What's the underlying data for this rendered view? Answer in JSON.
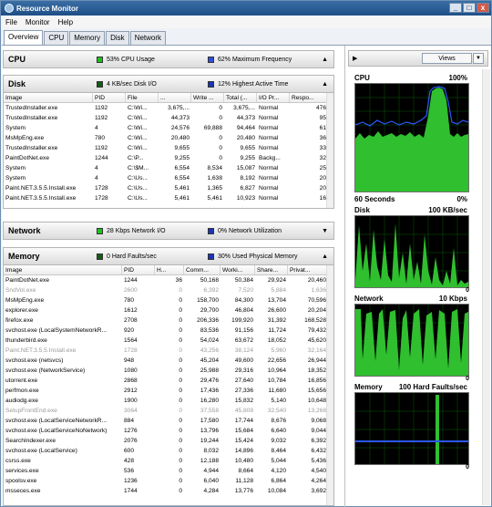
{
  "window": {
    "title": "Resource Monitor",
    "min": "_",
    "max": "□",
    "close": "x"
  },
  "menu": [
    "File",
    "Monitor",
    "Help"
  ],
  "tabs": [
    "Overview",
    "CPU",
    "Memory",
    "Disk",
    "Network"
  ],
  "cpu": {
    "title": "CPU",
    "ind1": "53% CPU Usage",
    "ind1_color": "#1cc41c",
    "ind2": "62% Maximum Frequency",
    "ind2_color": "#2f4fd8"
  },
  "disk": {
    "title": "Disk",
    "ind1": "4 KB/sec Disk I/O",
    "ind1_color": "#155c15",
    "ind2": "12% Highest Active Time",
    "ind2_color": "#1a35b8",
    "columns": [
      "Image",
      "PID",
      "File",
      "...",
      "Write ...",
      "Total (...",
      "I/O Pr...",
      "Respo..."
    ],
    "rows": [
      [
        "TrustedInstaller.exe",
        "1192",
        "C:\\Wi...",
        "3,675,...",
        "0",
        "3,675,...",
        "Normal",
        "476"
      ],
      [
        "TrustedInstaller.exe",
        "1192",
        "C:\\Wi...",
        "44,373",
        "0",
        "44,373",
        "Normal",
        "95"
      ],
      [
        "System",
        "4",
        "C:\\Wi...",
        "24,576",
        "69,888",
        "94,464",
        "Normal",
        "61"
      ],
      [
        "MsMpEng.exe",
        "780",
        "C:\\Wi...",
        "20,480",
        "0",
        "20,480",
        "Normal",
        "36"
      ],
      [
        "TrustedInstaller.exe",
        "1192",
        "C:\\Wi...",
        "9,655",
        "0",
        "9,655",
        "Normal",
        "33"
      ],
      [
        "PaintDotNet.exe",
        "1244",
        "C:\\P...",
        "9,255",
        "0",
        "9,255",
        "Backg...",
        "32"
      ],
      [
        "System",
        "4",
        "C:\\$M...",
        "6,554",
        "8,534",
        "15,087",
        "Normal",
        "25"
      ],
      [
        "System",
        "4",
        "C:\\Us...",
        "6,554",
        "1,638",
        "8,192",
        "Normal",
        "20"
      ],
      [
        "Paint.NET.3.5.5.Install.exe",
        "1728",
        "C:\\Us...",
        "5,461",
        "1,365",
        "6,827",
        "Normal",
        "20"
      ],
      [
        "Paint.NET.3.5.5.Install.exe",
        "1728",
        "C:\\Us...",
        "5,461",
        "5,461",
        "10,923",
        "Normal",
        "16"
      ]
    ]
  },
  "network": {
    "title": "Network",
    "ind1": "28 Kbps Network I/O",
    "ind1_color": "#1cc41c",
    "ind2": "0% Network Utilization",
    "ind2_color": "#1a35b8"
  },
  "memory": {
    "title": "Memory",
    "ind1": "0 Hard Faults/sec",
    "ind1_color": "#155c15",
    "ind2": "30% Used Physical Memory",
    "ind2_color": "#1a35b8",
    "columns": [
      "Image",
      "PID",
      "H...",
      "Comm...",
      "Worki...",
      "Share...",
      "Privat..."
    ],
    "rows": [
      [
        "PaintDotNet.exe",
        "1244",
        "36",
        "50,168",
        "50,384",
        "29,924",
        "20,460",
        false
      ],
      [
        "SndVol.exe",
        "2600",
        "0",
        "6,392",
        "7,520",
        "5,884",
        "1,636",
        true
      ],
      [
        "MsMpEng.exe",
        "780",
        "0",
        "158,700",
        "84,300",
        "13,704",
        "70,596",
        false
      ],
      [
        "explorer.exe",
        "1612",
        "0",
        "29,700",
        "46,804",
        "26,600",
        "20,204",
        false
      ],
      [
        "firefox.exe",
        "2708",
        "0",
        "206,336",
        "199,920",
        "31,392",
        "168,528",
        false
      ],
      [
        "svchost.exe (LocalSystemNetworkR...",
        "920",
        "0",
        "83,536",
        "91,156",
        "11,724",
        "79,432",
        false
      ],
      [
        "thunderbird.exe",
        "1564",
        "0",
        "54,024",
        "63,672",
        "18,052",
        "45,620",
        false
      ],
      [
        "Paint.NET.3.5.5.Install.exe",
        "1728",
        "0",
        "43,256",
        "38,124",
        "5,960",
        "32,164",
        true
      ],
      [
        "svchost.exe (netsvcs)",
        "948",
        "0",
        "45,204",
        "49,600",
        "22,656",
        "26,944",
        false
      ],
      [
        "svchost.exe (NetworkService)",
        "1080",
        "0",
        "25,988",
        "29,316",
        "10,964",
        "18,352",
        false
      ],
      [
        "utorrent.exe",
        "2868",
        "0",
        "29,476",
        "27,640",
        "10,784",
        "16,856",
        false
      ],
      [
        "perfmon.exe",
        "2912",
        "0",
        "17,436",
        "27,336",
        "11,680",
        "15,656",
        false
      ],
      [
        "audiodg.exe",
        "1900",
        "0",
        "16,280",
        "15,832",
        "5,140",
        "10,648",
        false
      ],
      [
        "SetupFrontEnd.exe",
        "3064",
        "0",
        "37,558",
        "45,808",
        "32,540",
        "13,268",
        true
      ],
      [
        "svchost.exe (LocalServiceNetworkR...",
        "884",
        "0",
        "17,580",
        "17,744",
        "8,676",
        "9,068",
        false
      ],
      [
        "svchost.exe (LocalServiceNoNetwork)",
        "1276",
        "0",
        "13,796",
        "15,684",
        "6,640",
        "9,044",
        false
      ],
      [
        "SearchIndexer.exe",
        "2076",
        "0",
        "19,244",
        "15,424",
        "9,032",
        "6,392",
        false
      ],
      [
        "svchost.exe (LocalService)",
        "600",
        "0",
        "8,032",
        "14,896",
        "8,464",
        "6,432",
        false
      ],
      [
        "csrss.exe",
        "428",
        "0",
        "12,188",
        "10,480",
        "5,044",
        "5,436",
        false
      ],
      [
        "services.exe",
        "536",
        "0",
        "4,944",
        "8,664",
        "4,120",
        "4,540",
        false
      ],
      [
        "spoolsv.exe",
        "1236",
        "0",
        "6,040",
        "11,128",
        "6,864",
        "4,264",
        false
      ],
      [
        "msseces.exe",
        "1744",
        "0",
        "4,284",
        "13,776",
        "10,084",
        "3,692",
        false
      ]
    ]
  },
  "views_button": "Views",
  "graphs": {
    "cpu": {
      "label": "CPU",
      "max": "100%",
      "bottom_left": "60 Seconds",
      "bottom_right": "0%"
    },
    "disk": {
      "label": "Disk",
      "max": "100 KB/sec",
      "min": "0"
    },
    "network": {
      "label": "Network",
      "max": "10 Kbps",
      "min": "0"
    },
    "memory": {
      "label": "Memory",
      "max": "100 Hard Faults/sec",
      "min": "0"
    }
  }
}
